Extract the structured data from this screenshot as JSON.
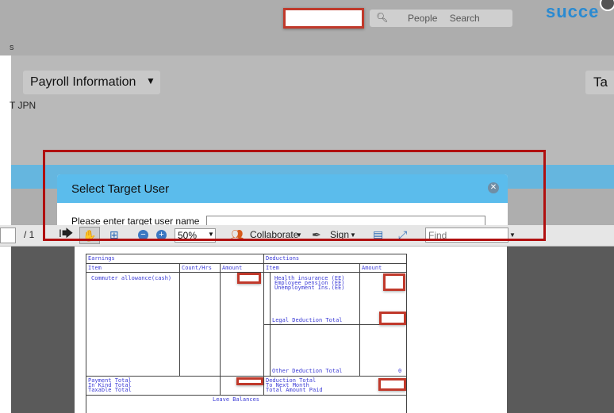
{
  "header": {
    "search_placeholder": "People Search",
    "brand": "succe",
    "left_fragment": "s"
  },
  "page": {
    "payroll_button": "Payroll Information",
    "right_fragment": "Ta",
    "sub_label": "T JPN"
  },
  "dialog": {
    "title": "Select Target User",
    "prompt": "Please enter target user name"
  },
  "pdf_toolbar": {
    "page_current": "",
    "page_total": "/ 1",
    "zoom": "50%",
    "collaborate": "Collaborate",
    "sign": "Sign",
    "find_placeholder": "Find"
  },
  "payslip": {
    "earnings_header": "Earnings",
    "deductions_header": "Deductions",
    "col_item": "Item",
    "col_count": "Count/Hrs",
    "col_amount": "Amount",
    "col_item_d": "Item",
    "col_amount_d": "Amount",
    "earning_1": "Commuter allowance(cash)",
    "deduction_1": "Health insurance (EE)",
    "deduction_2": "Employee pension (EE)",
    "deduction_3": "Unemployment Ins.(EE)",
    "legal_total": "Legal Deduction Total",
    "other_total": "Other Deduction Total",
    "other_total_value": "0",
    "payment_total": "Payment Total",
    "in_kind_total": "In Kind Total",
    "taxable_total": "Taxable Total",
    "deduction_total": "Deduction Total",
    "to_next_month": "To Next Month",
    "total_amount_paid": "Total Amount Paid",
    "leave_balances": "Leave Balances"
  },
  "colors": {
    "accent_blue": "#5bbcec",
    "redbox": "#c0392b",
    "highlight_border": "#b01010",
    "pdf_text": "#3b3bd6"
  }
}
